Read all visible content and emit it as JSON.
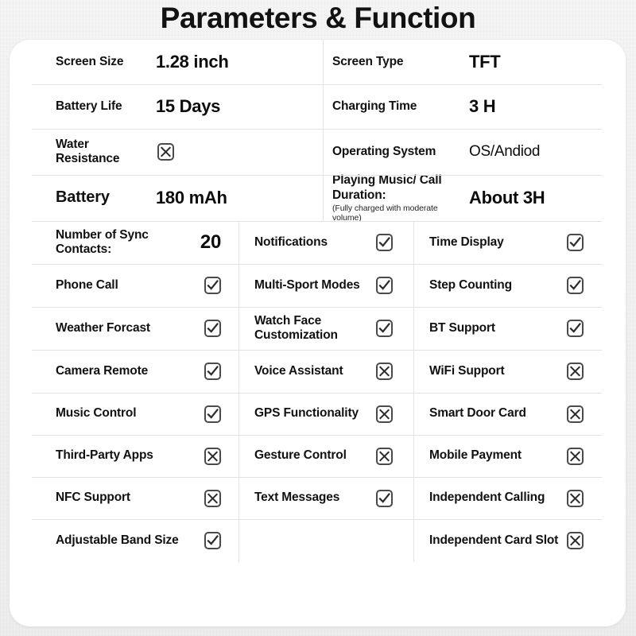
{
  "title": "Parameters & Function",
  "icons": {
    "check": "checkbox-checked-icon",
    "cross": "checkbox-crossed-icon"
  },
  "colors": {
    "background": "#f2f2f2",
    "card": "#ffffff",
    "text": "#111111",
    "divider": "#e3e3e3",
    "checkbox_border": "#4a4a4a"
  },
  "spec_rows": [
    {
      "left_label": "Screen Size",
      "left_value": "1.28 inch",
      "right_label": "Screen Type",
      "right_value": "TFT"
    },
    {
      "left_label": "Battery Life",
      "left_value": "15 Days",
      "right_label": "Charging Time",
      "right_value": "3 H"
    },
    {
      "left_label": "Water Resistance",
      "left_value": "cross",
      "right_label": "Operating System",
      "right_value": "OS/Andiod"
    },
    {
      "left_label": "Battery",
      "left_value": "180 mAh",
      "right_label": "Playing Music/ Call Duration:",
      "right_note": "(Fully charged with moderate volume)",
      "right_value": "About 3H"
    }
  ],
  "feature_rows": [
    [
      {
        "label": "Number of Sync Contacts:",
        "value": "20",
        "type": "text"
      },
      {
        "label": "Notifications",
        "value": "check",
        "type": "mark"
      },
      {
        "label": "Time Display",
        "value": "check",
        "type": "mark"
      }
    ],
    [
      {
        "label": "Phone Call",
        "value": "check",
        "type": "mark"
      },
      {
        "label": "Multi-Sport Modes",
        "value": "check",
        "type": "mark"
      },
      {
        "label": "Step Counting",
        "value": "check",
        "type": "mark"
      }
    ],
    [
      {
        "label": "Weather Forcast",
        "value": "check",
        "type": "mark"
      },
      {
        "label": "Watch Face Customization",
        "value": "check",
        "type": "mark"
      },
      {
        "label": "BT Support",
        "value": "check",
        "type": "mark"
      }
    ],
    [
      {
        "label": "Camera Remote",
        "value": "check",
        "type": "mark"
      },
      {
        "label": "Voice Assistant",
        "value": "cross",
        "type": "mark"
      },
      {
        "label": "WiFi Support",
        "value": "cross",
        "type": "mark"
      }
    ],
    [
      {
        "label": "Music Control",
        "value": "check",
        "type": "mark"
      },
      {
        "label": "GPS Functionality",
        "value": "cross",
        "type": "mark"
      },
      {
        "label": "Smart Door Card",
        "value": "cross",
        "type": "mark"
      }
    ],
    [
      {
        "label": "Third-Party Apps",
        "value": "cross",
        "type": "mark"
      },
      {
        "label": "Gesture Control",
        "value": "cross",
        "type": "mark"
      },
      {
        "label": "Mobile Payment",
        "value": "cross",
        "type": "mark"
      }
    ],
    [
      {
        "label": "NFC Support",
        "value": "cross",
        "type": "mark"
      },
      {
        "label": "Text Messages",
        "value": "check",
        "type": "mark"
      },
      {
        "label": "Independent Calling",
        "value": "cross",
        "type": "mark"
      }
    ],
    [
      {
        "label": "Adjustable Band Size",
        "value": "check",
        "type": "mark"
      },
      {
        "label": "",
        "value": "",
        "type": "empty"
      },
      {
        "label": "Independent Card Slot",
        "value": "cross",
        "type": "mark"
      }
    ]
  ]
}
